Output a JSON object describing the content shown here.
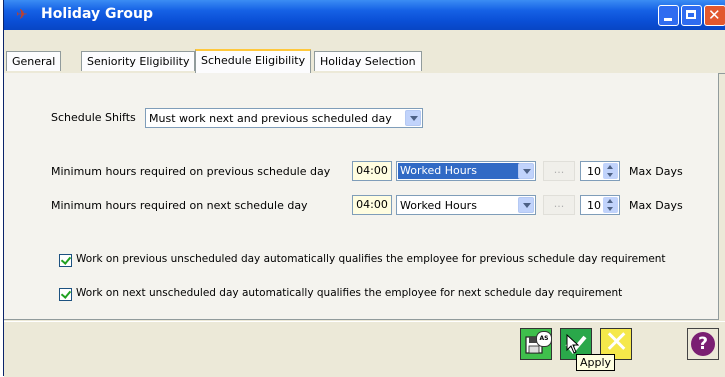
{
  "window": {
    "title": "Holiday Group"
  },
  "tabs": [
    {
      "label": "General"
    },
    {
      "label": "Seniority Eligibility"
    },
    {
      "label": "Schedule Eligibility"
    },
    {
      "label": "Holiday Selection"
    }
  ],
  "active_tab": "Schedule Eligibility",
  "schedule_shifts": {
    "label": "Schedule Shifts",
    "value": "Must work next and previous scheduled day"
  },
  "rows": [
    {
      "label": "Minimum hours required on previous schedule day",
      "time": "04:00",
      "hours_type": "Worked Hours",
      "ellipsis": "...",
      "days": "10",
      "days_label": "Max Days"
    },
    {
      "label": "Minimum hours required on next schedule day",
      "time": "04:00",
      "hours_type": "Worked Hours",
      "ellipsis": "...",
      "days": "10",
      "days_label": "Max Days"
    }
  ],
  "checkboxes": [
    {
      "label": "Work on previous unscheduled day automatically qualifies the employee for previous schedule day requirement",
      "checked": true
    },
    {
      "label": "Work on next unscheduled day automatically qualifies the employee for next schedule day requirement",
      "checked": true
    }
  ],
  "actions": {
    "save_badge": "AS",
    "help_symbol": "?",
    "tooltip": "Apply"
  },
  "icons": [
    "holiday-app-icon",
    "minimize-icon",
    "maximize-icon",
    "close-icon",
    "save-as-icon",
    "apply-check-icon",
    "cancel-x-icon",
    "help-icon",
    "mouse-cursor-icon"
  ],
  "colors": {
    "titlebar": "#0a4fd6",
    "active_tab_accent": "#ffc83c",
    "selection": "#316ac5"
  }
}
